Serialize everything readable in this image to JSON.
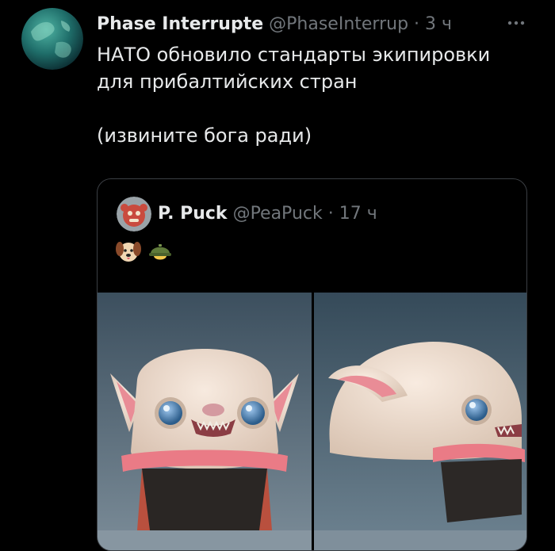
{
  "tweet": {
    "display_name": "Phase Interrupte",
    "handle": "@PhaseInterrup",
    "separator": "·",
    "time": "3 ч",
    "more_icon": "more-horizontal-icon",
    "text_line1": "НАТО обновило стандарты экипировки",
    "text_line2": "для прибалтийских стран",
    "text_line3": "(извините бога ради)"
  },
  "quote": {
    "display_name": "P. Puck",
    "handle": "@PeaPuck",
    "separator": "·",
    "time": "17 ч",
    "emojis": [
      "dog-face-emoji",
      "military-helmet-emoji"
    ],
    "photos": [
      "helmet-front-photo",
      "helmet-side-photo"
    ]
  },
  "colors": {
    "background": "#000000",
    "primary_text": "#e7e9ea",
    "secondary_text": "#71767b",
    "border": "#3b3f44"
  }
}
